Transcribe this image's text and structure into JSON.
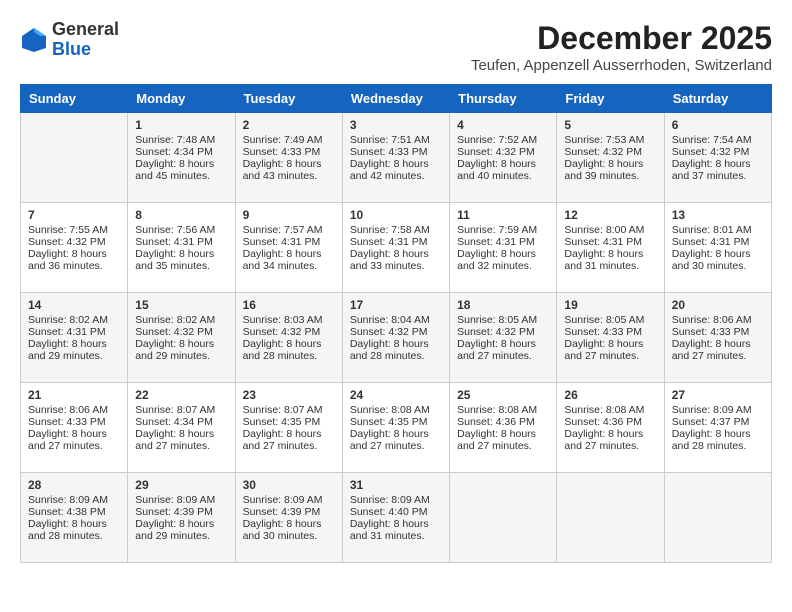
{
  "header": {
    "logo": {
      "general": "General",
      "blue": "Blue"
    },
    "title": "December 2025",
    "location": "Teufen, Appenzell Ausserrhoden, Switzerland"
  },
  "days_of_week": [
    "Sunday",
    "Monday",
    "Tuesday",
    "Wednesday",
    "Thursday",
    "Friday",
    "Saturday"
  ],
  "weeks": [
    [
      {
        "day": "",
        "sunrise": "",
        "sunset": "",
        "daylight": ""
      },
      {
        "day": "1",
        "sunrise": "Sunrise: 7:48 AM",
        "sunset": "Sunset: 4:34 PM",
        "daylight": "Daylight: 8 hours and 45 minutes."
      },
      {
        "day": "2",
        "sunrise": "Sunrise: 7:49 AM",
        "sunset": "Sunset: 4:33 PM",
        "daylight": "Daylight: 8 hours and 43 minutes."
      },
      {
        "day": "3",
        "sunrise": "Sunrise: 7:51 AM",
        "sunset": "Sunset: 4:33 PM",
        "daylight": "Daylight: 8 hours and 42 minutes."
      },
      {
        "day": "4",
        "sunrise": "Sunrise: 7:52 AM",
        "sunset": "Sunset: 4:32 PM",
        "daylight": "Daylight: 8 hours and 40 minutes."
      },
      {
        "day": "5",
        "sunrise": "Sunrise: 7:53 AM",
        "sunset": "Sunset: 4:32 PM",
        "daylight": "Daylight: 8 hours and 39 minutes."
      },
      {
        "day": "6",
        "sunrise": "Sunrise: 7:54 AM",
        "sunset": "Sunset: 4:32 PM",
        "daylight": "Daylight: 8 hours and 37 minutes."
      }
    ],
    [
      {
        "day": "7",
        "sunrise": "Sunrise: 7:55 AM",
        "sunset": "Sunset: 4:32 PM",
        "daylight": "Daylight: 8 hours and 36 minutes."
      },
      {
        "day": "8",
        "sunrise": "Sunrise: 7:56 AM",
        "sunset": "Sunset: 4:31 PM",
        "daylight": "Daylight: 8 hours and 35 minutes."
      },
      {
        "day": "9",
        "sunrise": "Sunrise: 7:57 AM",
        "sunset": "Sunset: 4:31 PM",
        "daylight": "Daylight: 8 hours and 34 minutes."
      },
      {
        "day": "10",
        "sunrise": "Sunrise: 7:58 AM",
        "sunset": "Sunset: 4:31 PM",
        "daylight": "Daylight: 8 hours and 33 minutes."
      },
      {
        "day": "11",
        "sunrise": "Sunrise: 7:59 AM",
        "sunset": "Sunset: 4:31 PM",
        "daylight": "Daylight: 8 hours and 32 minutes."
      },
      {
        "day": "12",
        "sunrise": "Sunrise: 8:00 AM",
        "sunset": "Sunset: 4:31 PM",
        "daylight": "Daylight: 8 hours and 31 minutes."
      },
      {
        "day": "13",
        "sunrise": "Sunrise: 8:01 AM",
        "sunset": "Sunset: 4:31 PM",
        "daylight": "Daylight: 8 hours and 30 minutes."
      }
    ],
    [
      {
        "day": "14",
        "sunrise": "Sunrise: 8:02 AM",
        "sunset": "Sunset: 4:31 PM",
        "daylight": "Daylight: 8 hours and 29 minutes."
      },
      {
        "day": "15",
        "sunrise": "Sunrise: 8:02 AM",
        "sunset": "Sunset: 4:32 PM",
        "daylight": "Daylight: 8 hours and 29 minutes."
      },
      {
        "day": "16",
        "sunrise": "Sunrise: 8:03 AM",
        "sunset": "Sunset: 4:32 PM",
        "daylight": "Daylight: 8 hours and 28 minutes."
      },
      {
        "day": "17",
        "sunrise": "Sunrise: 8:04 AM",
        "sunset": "Sunset: 4:32 PM",
        "daylight": "Daylight: 8 hours and 28 minutes."
      },
      {
        "day": "18",
        "sunrise": "Sunrise: 8:05 AM",
        "sunset": "Sunset: 4:32 PM",
        "daylight": "Daylight: 8 hours and 27 minutes."
      },
      {
        "day": "19",
        "sunrise": "Sunrise: 8:05 AM",
        "sunset": "Sunset: 4:33 PM",
        "daylight": "Daylight: 8 hours and 27 minutes."
      },
      {
        "day": "20",
        "sunrise": "Sunrise: 8:06 AM",
        "sunset": "Sunset: 4:33 PM",
        "daylight": "Daylight: 8 hours and 27 minutes."
      }
    ],
    [
      {
        "day": "21",
        "sunrise": "Sunrise: 8:06 AM",
        "sunset": "Sunset: 4:33 PM",
        "daylight": "Daylight: 8 hours and 27 minutes."
      },
      {
        "day": "22",
        "sunrise": "Sunrise: 8:07 AM",
        "sunset": "Sunset: 4:34 PM",
        "daylight": "Daylight: 8 hours and 27 minutes."
      },
      {
        "day": "23",
        "sunrise": "Sunrise: 8:07 AM",
        "sunset": "Sunset: 4:35 PM",
        "daylight": "Daylight: 8 hours and 27 minutes."
      },
      {
        "day": "24",
        "sunrise": "Sunrise: 8:08 AM",
        "sunset": "Sunset: 4:35 PM",
        "daylight": "Daylight: 8 hours and 27 minutes."
      },
      {
        "day": "25",
        "sunrise": "Sunrise: 8:08 AM",
        "sunset": "Sunset: 4:36 PM",
        "daylight": "Daylight: 8 hours and 27 minutes."
      },
      {
        "day": "26",
        "sunrise": "Sunrise: 8:08 AM",
        "sunset": "Sunset: 4:36 PM",
        "daylight": "Daylight: 8 hours and 27 minutes."
      },
      {
        "day": "27",
        "sunrise": "Sunrise: 8:09 AM",
        "sunset": "Sunset: 4:37 PM",
        "daylight": "Daylight: 8 hours and 28 minutes."
      }
    ],
    [
      {
        "day": "28",
        "sunrise": "Sunrise: 8:09 AM",
        "sunset": "Sunset: 4:38 PM",
        "daylight": "Daylight: 8 hours and 28 minutes."
      },
      {
        "day": "29",
        "sunrise": "Sunrise: 8:09 AM",
        "sunset": "Sunset: 4:39 PM",
        "daylight": "Daylight: 8 hours and 29 minutes."
      },
      {
        "day": "30",
        "sunrise": "Sunrise: 8:09 AM",
        "sunset": "Sunset: 4:39 PM",
        "daylight": "Daylight: 8 hours and 30 minutes."
      },
      {
        "day": "31",
        "sunrise": "Sunrise: 8:09 AM",
        "sunset": "Sunset: 4:40 PM",
        "daylight": "Daylight: 8 hours and 31 minutes."
      },
      {
        "day": "",
        "sunrise": "",
        "sunset": "",
        "daylight": ""
      },
      {
        "day": "",
        "sunrise": "",
        "sunset": "",
        "daylight": ""
      },
      {
        "day": "",
        "sunrise": "",
        "sunset": "",
        "daylight": ""
      }
    ]
  ]
}
